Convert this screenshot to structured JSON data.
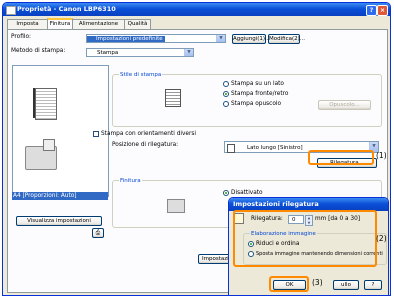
{
  "window": {
    "title": "Proprietà - Canon LBP6310"
  },
  "tabs": [
    "Imposta pagina",
    "Finitura",
    "Alimentazione carta",
    "Qualità"
  ],
  "profile": {
    "label": "Profilo:",
    "value": "Impostazioni predefinite",
    "add": "Aggiungi(1)...",
    "modify": "Modifica(2)..."
  },
  "output_method": {
    "label": "Metodo di stampa:",
    "value": "Stampa"
  },
  "print_style": {
    "title": "Stile di stampa",
    "options": [
      "Stampa su un lato",
      "Stampa fronte/retro",
      "Stampa opuscolo"
    ],
    "booklet_button": "Opuscolo..."
  },
  "rotated_checkbox": "Stampa con orientamenti diversi",
  "binding": {
    "label": "Posizione di rilegatura:",
    "value": "Lato lungo [Sinistro]",
    "button": "Rilegatura..."
  },
  "finishing": {
    "title": "Finitura",
    "option": "Disattivato"
  },
  "preview": {
    "caption": "A4 [Proporzioni: Auto]",
    "view_button": "Visualizza impostazioni"
  },
  "bottom": {
    "printer_settings": "Impostazioni st"
  },
  "dialog": {
    "title": "Impostazioni rilegatura",
    "gutter_label": "Rilegatura:",
    "gutter_value": "0",
    "gutter_unit": "mm [da 0 a 30]",
    "group_title": "Elaborazione immagine",
    "options": [
      "Riduci e ordina",
      "Sposta immagine mantenendo dimensioni correnti"
    ],
    "ok": "OK",
    "cancel": "ullo",
    "help": "?"
  },
  "callouts": [
    "(1)",
    "(2)",
    "(3)"
  ],
  "colors": {
    "highlight": "#ff8a00",
    "title_blue": "#0a50d8"
  }
}
